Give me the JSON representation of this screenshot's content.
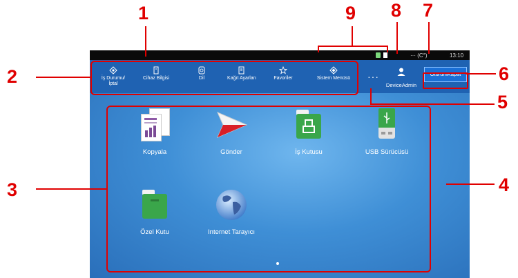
{
  "callouts": {
    "n1": "1",
    "n2": "2",
    "n3": "3",
    "n4": "4",
    "n5": "5",
    "n6": "6",
    "n7": "7",
    "n8": "8",
    "n9": "9"
  },
  "status_bar": {
    "indicator": "··· (C°)",
    "time": "13:10"
  },
  "toolbar": {
    "items": [
      {
        "label": "İş Durumu/\nİptal",
        "icon": "job-status-icon"
      },
      {
        "label": "Cihaz Bilgisi",
        "icon": "device-info-icon"
      },
      {
        "label": "Dil",
        "icon": "language-icon"
      },
      {
        "label": "Kağıt Ayarları",
        "icon": "paper-settings-icon"
      },
      {
        "label": "Favoriler",
        "icon": "star-icon"
      },
      {
        "label": "Sistem Menüsü",
        "icon": "system-menu-icon"
      }
    ],
    "more": "···",
    "user_name": "DeviceAdmin",
    "logout_label": "OturumKapat"
  },
  "apps": [
    {
      "label": "Kopyala",
      "icon": "copy-icon"
    },
    {
      "label": "Gönder",
      "icon": "send-icon"
    },
    {
      "label": "İş Kutusu",
      "icon": "job-box-icon"
    },
    {
      "label": "USB Sürücüsü",
      "icon": "usb-drive-icon"
    },
    {
      "label": "Özel Kutu",
      "icon": "custom-box-icon"
    },
    {
      "label": "Internet Tarayıcı",
      "icon": "internet-browser-icon"
    }
  ],
  "colors": {
    "callout": "#e00000",
    "toolbar": "#1f62b2",
    "logout": "#1a6fd6"
  }
}
